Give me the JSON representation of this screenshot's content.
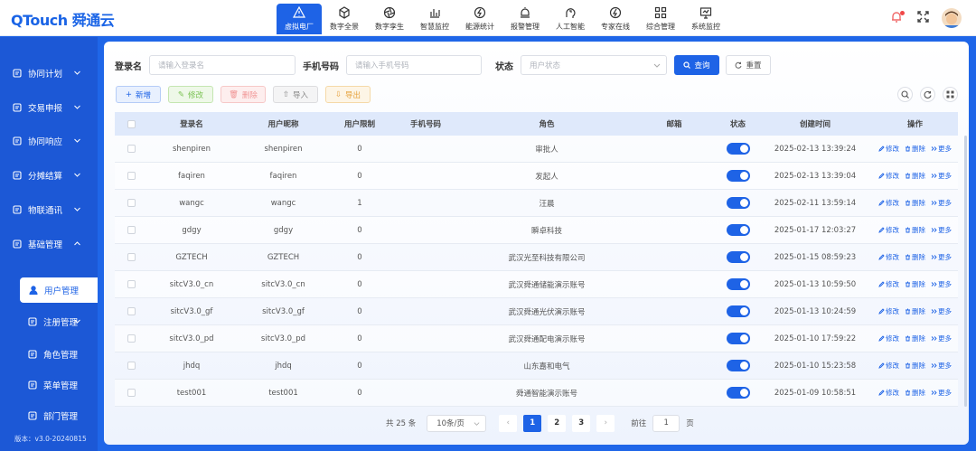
{
  "app": {
    "logo_a": "QTouch",
    "logo_b": "舜通云"
  },
  "nav": [
    {
      "label": "虚拟电厂",
      "icon": "warning-triangle-icon",
      "active": true
    },
    {
      "label": "数字全景",
      "icon": "cube-icon"
    },
    {
      "label": "数字孪生",
      "icon": "aperture-icon"
    },
    {
      "label": "智慧监控",
      "icon": "bar-chart-icon"
    },
    {
      "label": "能源统计",
      "icon": "lightning-icon"
    },
    {
      "label": "报警管理",
      "icon": "alarm-icon"
    },
    {
      "label": "人工智能",
      "icon": "ai-head-icon"
    },
    {
      "label": "专家在线",
      "icon": "expert-icon"
    },
    {
      "label": "综合管理",
      "icon": "grid-icon"
    },
    {
      "label": "系统监控",
      "icon": "monitor-icon"
    }
  ],
  "sidebar": {
    "items": [
      {
        "label": "协同计划",
        "icon": "plan-icon",
        "expandable": true
      },
      {
        "label": "交易申报",
        "icon": "trade-icon",
        "expandable": true
      },
      {
        "label": "协同响应",
        "icon": "response-icon",
        "expandable": true
      },
      {
        "label": "分摊结算",
        "icon": "settle-icon",
        "expandable": true
      },
      {
        "label": "物联通讯",
        "icon": "iot-icon",
        "expandable": true
      },
      {
        "label": "基础管理",
        "icon": "base-icon",
        "expandable": true,
        "expanded": true
      }
    ],
    "sub_items": [
      {
        "label": "用户管理",
        "icon": "user-icon",
        "active": true
      },
      {
        "label": "注册管理",
        "icon": "register-icon",
        "expandable": true
      },
      {
        "label": "角色管理",
        "icon": "role-icon"
      },
      {
        "label": "菜单管理",
        "icon": "menu-icon"
      },
      {
        "label": "部门管理",
        "icon": "dept-icon"
      }
    ],
    "version": "版本：v3.0-20240815"
  },
  "search": {
    "login_label": "登录名",
    "login_placeholder": "请输入登录名",
    "phone_label": "手机号码",
    "phone_placeholder": "请输入手机号码",
    "status_label": "状态",
    "status_placeholder": "用户状态",
    "query_label": "查询",
    "reset_label": "重置"
  },
  "actions": {
    "add": "新增",
    "edit": "修改",
    "delete": "删除",
    "import": "导入",
    "export": "导出"
  },
  "table": {
    "headers": [
      "登录名",
      "用户昵称",
      "用户限制",
      "手机号码",
      "角色",
      "邮箱",
      "状态",
      "创建时间",
      "操作"
    ],
    "op_labels": {
      "edit": "修改",
      "delete": "删除",
      "more": "更多"
    },
    "rows": [
      {
        "login": "shenpiren",
        "nick": "shenpiren",
        "limit": "0",
        "phone": "",
        "role": "审批人",
        "email": "",
        "enabled": true,
        "created": "2025-02-13 13:39:24"
      },
      {
        "login": "faqiren",
        "nick": "faqiren",
        "limit": "0",
        "phone": "",
        "role": "发起人",
        "email": "",
        "enabled": true,
        "created": "2025-02-13 13:39:04"
      },
      {
        "login": "wangc",
        "nick": "wangc",
        "limit": "1",
        "phone": "",
        "role": "汪晨",
        "email": "",
        "enabled": true,
        "created": "2025-02-11 13:59:14"
      },
      {
        "login": "gdgy",
        "nick": "gdgy",
        "limit": "0",
        "phone": "",
        "role": "瞬卓科技",
        "email": "",
        "enabled": true,
        "created": "2025-01-17 12:03:27"
      },
      {
        "login": "GZTECH",
        "nick": "GZTECH",
        "limit": "0",
        "phone": "",
        "role": "武汉光至科技有限公司",
        "email": "",
        "enabled": true,
        "created": "2025-01-15 08:59:23"
      },
      {
        "login": "sitcV3.0_cn",
        "nick": "sitcV3.0_cn",
        "limit": "0",
        "phone": "",
        "role": "武汉舜通储能演示账号",
        "email": "",
        "enabled": true,
        "created": "2025-01-13 10:59:50"
      },
      {
        "login": "sitcV3.0_gf",
        "nick": "sitcV3.0_gf",
        "limit": "0",
        "phone": "",
        "role": "武汉舜通光伏演示账号",
        "email": "",
        "enabled": true,
        "created": "2025-01-13 10:24:59"
      },
      {
        "login": "sitcV3.0_pd",
        "nick": "sitcV3.0_pd",
        "limit": "0",
        "phone": "",
        "role": "武汉舜通配电演示账号",
        "email": "",
        "enabled": true,
        "created": "2025-01-10 17:59:22"
      },
      {
        "login": "jhdq",
        "nick": "jhdq",
        "limit": "0",
        "phone": "",
        "role": "山东嘉和电气",
        "email": "",
        "enabled": true,
        "created": "2025-01-10 15:23:58"
      },
      {
        "login": "test001",
        "nick": "test001",
        "limit": "0",
        "phone": "",
        "role": "舜通智能演示账号",
        "email": "",
        "enabled": true,
        "created": "2025-01-09 10:58:51"
      }
    ]
  },
  "pagination": {
    "total": "共 25 条",
    "page_size": "10条/页",
    "pages": [
      "1",
      "2",
      "3"
    ],
    "current_page": "1",
    "goto_label": "前往",
    "goto_value": "1",
    "goto_unit": "页"
  },
  "colors": {
    "primary": "#1e63e6",
    "sidebar": "#1c58d6"
  }
}
